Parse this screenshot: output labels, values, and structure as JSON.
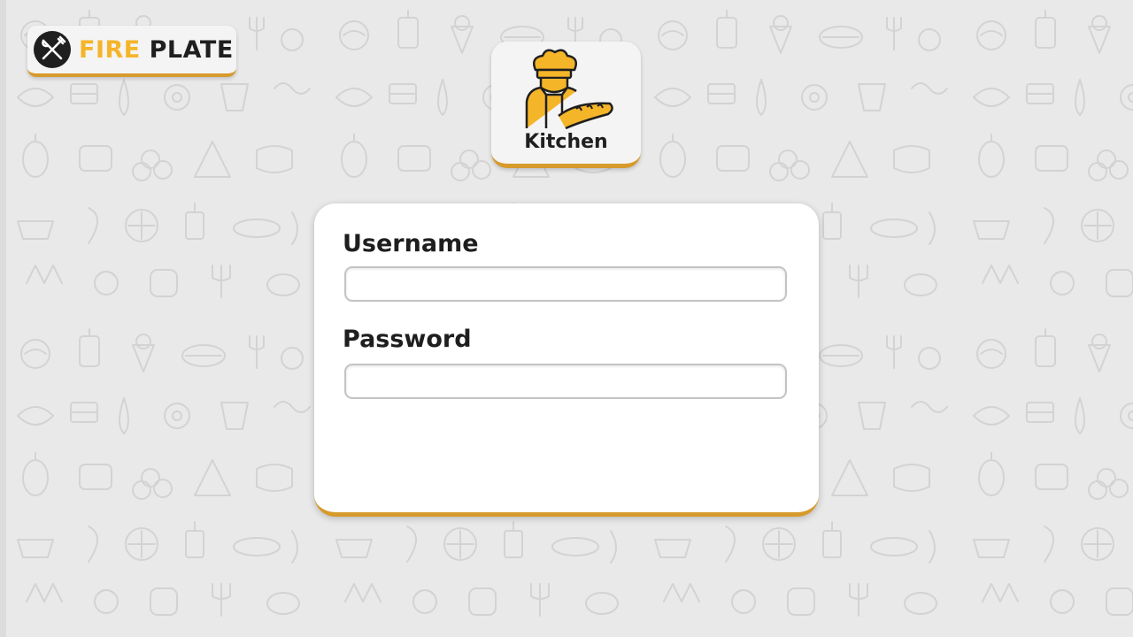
{
  "brand": {
    "name_part1": "FIRE",
    "name_part2": "PLATE",
    "logo_icon": "fork-knife-crossed-icon"
  },
  "role": {
    "label": "Kitchen",
    "icon": "chef-icon"
  },
  "login": {
    "username_label": "Username",
    "username_value": "",
    "password_label": "Password",
    "password_value": ""
  },
  "colors": {
    "accent": "#d79a2c",
    "brand_yellow": "#f5b529",
    "background": "#e9e9e9",
    "text": "#1f1f1f"
  }
}
